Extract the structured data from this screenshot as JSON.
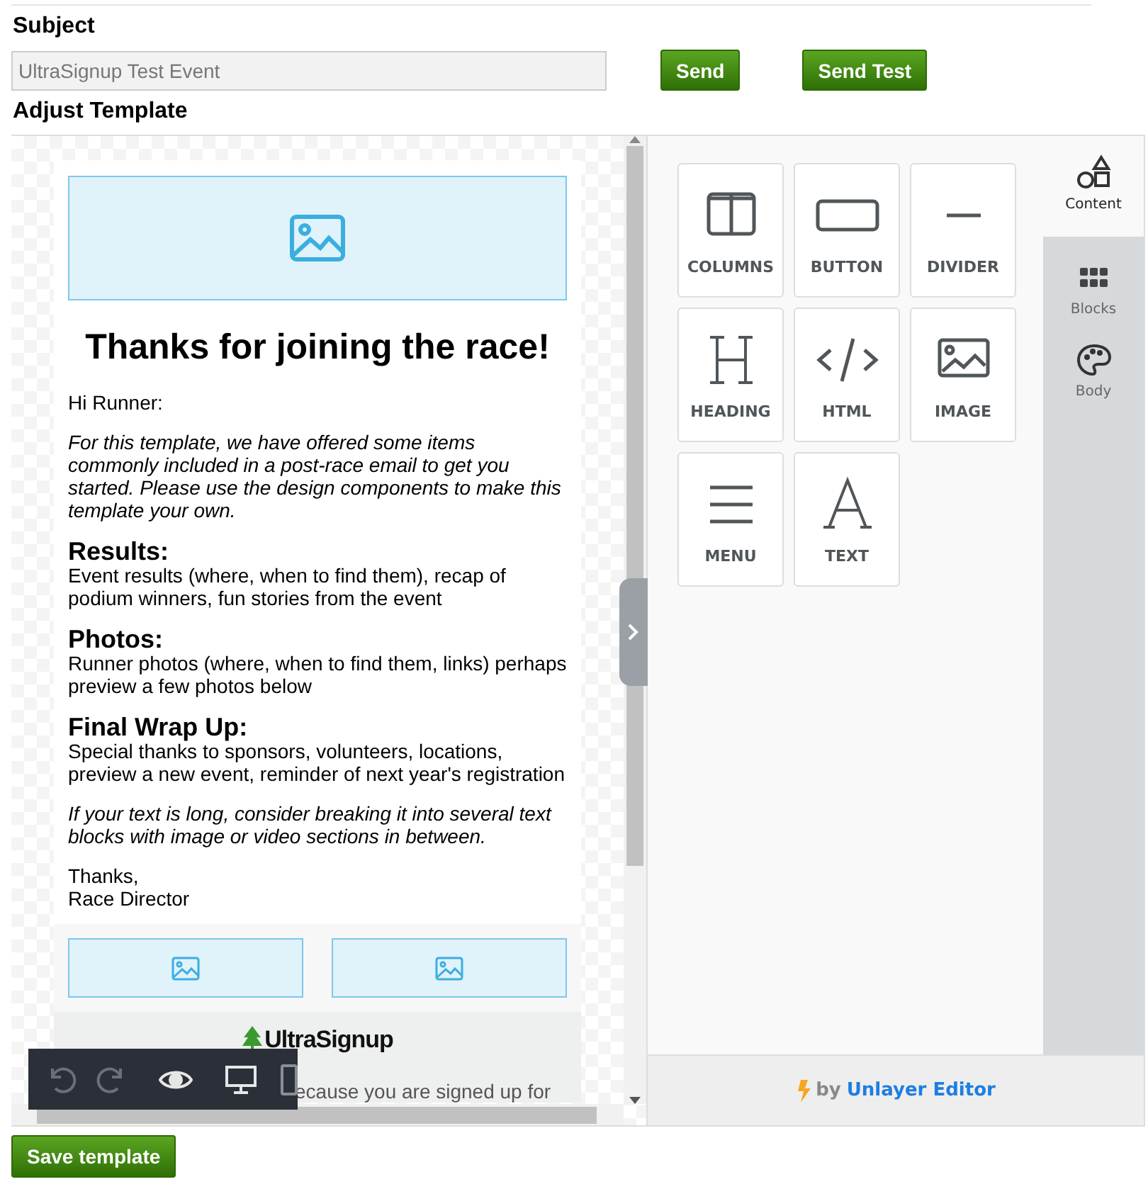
{
  "subject": {
    "label": "Subject",
    "value": "UltraSignup Test Event"
  },
  "actions": [
    {
      "label": "Send"
    },
    {
      "label": "Send Test"
    }
  ],
  "adjust_label": "Adjust Template",
  "email": {
    "heading": "Thanks for joining the race!",
    "greeting": "Hi Runner:",
    "intro": "For this template, we have offered some items commonly included in a post-race email to get you started. Please use the design components to make this template your own.",
    "sections": [
      {
        "title": "Results:",
        "body": "Event results (where, when to find them), recap of podium winners, fun stories from the event"
      },
      {
        "title": "Photos:",
        "body": "Runner photos (where, when to find them, links) perhaps preview a few photos below"
      },
      {
        "title": "Final Wrap Up:",
        "body": "Special thanks to sponsors, volunteers, locations, preview a new event, reminder of next year's registration"
      }
    ],
    "note": "If your text is long, consider breaking it into several text blocks with image or video sections in between.",
    "signoff": [
      "Thanks,",
      "Race Director"
    ],
    "logo": "UltraSignup",
    "footer_text": "ecause you are signed up for"
  },
  "toolbar": [
    {
      "kind": "undo",
      "disabled": true
    },
    {
      "kind": "redo",
      "disabled": true
    },
    {
      "kind": "preview",
      "disabled": false
    },
    {
      "kind": "desktop",
      "selected": true
    },
    {
      "kind": "mobile",
      "selected": false
    }
  ],
  "tools": [
    {
      "kind": "columns",
      "label": "COLUMNS"
    },
    {
      "kind": "button",
      "label": "BUTTON"
    },
    {
      "kind": "divider",
      "label": "DIVIDER"
    },
    {
      "kind": "heading",
      "label": "HEADING"
    },
    {
      "kind": "html",
      "label": "HTML"
    },
    {
      "kind": "image",
      "label": "IMAGE"
    },
    {
      "kind": "menu",
      "label": "MENU"
    },
    {
      "kind": "text",
      "label": "TEXT"
    }
  ],
  "tabs": [
    {
      "kind": "content",
      "label": "Content",
      "selected": true
    },
    {
      "kind": "blocks",
      "label": "Blocks",
      "selected": false
    },
    {
      "kind": "body",
      "label": "Body",
      "selected": false
    }
  ],
  "credit": {
    "prefix": "by",
    "brand": "Unlayer Editor"
  },
  "save_button": "Save template"
}
